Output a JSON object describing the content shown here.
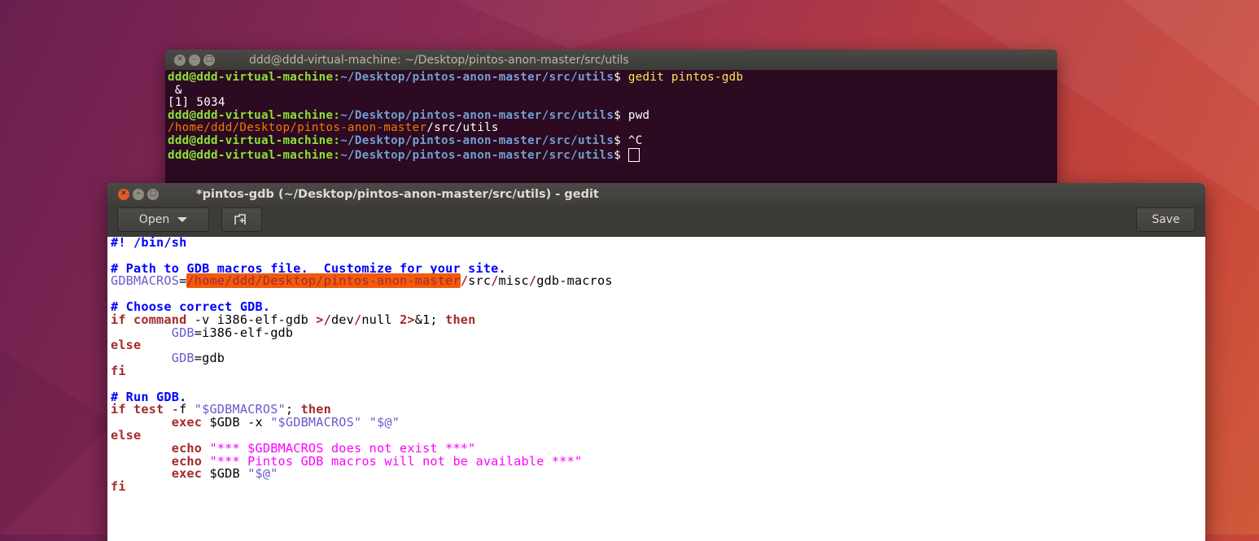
{
  "terminal": {
    "title": "ddd@ddd-virtual-machine: ~/Desktop/pintos-anon-master/src/utils",
    "lines": [
      {
        "user": "ddd@ddd-virtual-machine",
        "sep": ":",
        "path": "~/Desktop/pintos-anon-master/src/utils",
        "dollar": "$ ",
        "cmd": "gedit pintos-gdb"
      },
      {
        "text": " &"
      },
      {
        "text": "[1] 5034"
      },
      {
        "user": "ddd@ddd-virtual-machine",
        "sep": ":",
        "path": "~/Desktop/pintos-anon-master/src/utils",
        "dollar": "$ ",
        "cmd": "pwd"
      },
      {
        "orange": "/home/ddd/Desktop/pintos-anon-master",
        "rest": "/src/utils"
      },
      {
        "user": "ddd@ddd-virtual-machine",
        "sep": ":",
        "path": "~/Desktop/pintos-anon-master/src/utils",
        "dollar": "$ ",
        "cmd": "^C"
      },
      {
        "user": "ddd@ddd-virtual-machine",
        "sep": ":",
        "path": "~/Desktop/pintos-anon-master/src/utils",
        "dollar": "$ ",
        "cmd": ""
      }
    ]
  },
  "gedit": {
    "title": "*pintos-gdb (~/Desktop/pintos-anon-master/src/utils) - gedit",
    "open_label": "Open",
    "save_label": "Save",
    "new_tab_icon": "new-tab-icon",
    "code": {
      "shebang": "#! /bin/sh",
      "c1": "# Path to GDB macros file.  Customize for your site.",
      "gdbmacros_var": "GDBMACROS",
      "eq": "=",
      "gdbmacros_hl": "/home/ddd/Desktop/pintos-anon-master",
      "gdbmacros_s1": "/",
      "gdbmacros_src": "src",
      "gdbmacros_s2": "/",
      "gdbmacros_misc": "misc",
      "gdbmacros_s3": "/",
      "gdbmacros_file": "gdb-macros",
      "c2": "# Choose correct GDB.",
      "if_kw": "if",
      "command_kw": "command",
      "if_line_a": " -v i386-elf-gdb ",
      "gt1": ">",
      "devnull_s1": "/",
      "dev": "dev",
      "devnull_s2": "/",
      "null_txt": "null ",
      "redir": "2>",
      "amp1": "&1; ",
      "then_kw": "then",
      "indent": "        ",
      "gdb_var": "GDB",
      "gdb_val1": "i386-elf-gdb",
      "else_kw": "else",
      "gdb_val2": "gdb",
      "fi_kw": "fi",
      "c3": "# Run GDB.",
      "test_kw": "test",
      "test_a": " -f ",
      "test_str": "\"$GDBMACROS\"",
      "semi": "; ",
      "exec_kw": "exec",
      "exec_a": " $GDB -x ",
      "exec_str1": "\"$GDBMACROS\"",
      "sp": " ",
      "exec_str2": "\"$@\"",
      "echo_kw": "echo",
      "echo1_str": "\"*** $GDBMACROS does not exist ***\"",
      "echo2_str": "\"*** Pintos GDB macros will not be available ***\"",
      "exec2_a": " $GDB "
    }
  },
  "colors": {
    "terminal_bg": "#2c0a22",
    "prompt_user": "#8ae234",
    "prompt_path": "#729fcf",
    "highlight": "#f25a0c",
    "comment": "#0000ff",
    "keyword": "#a52a2a",
    "string": "#ff00ff",
    "variable": "#6a5acd"
  }
}
